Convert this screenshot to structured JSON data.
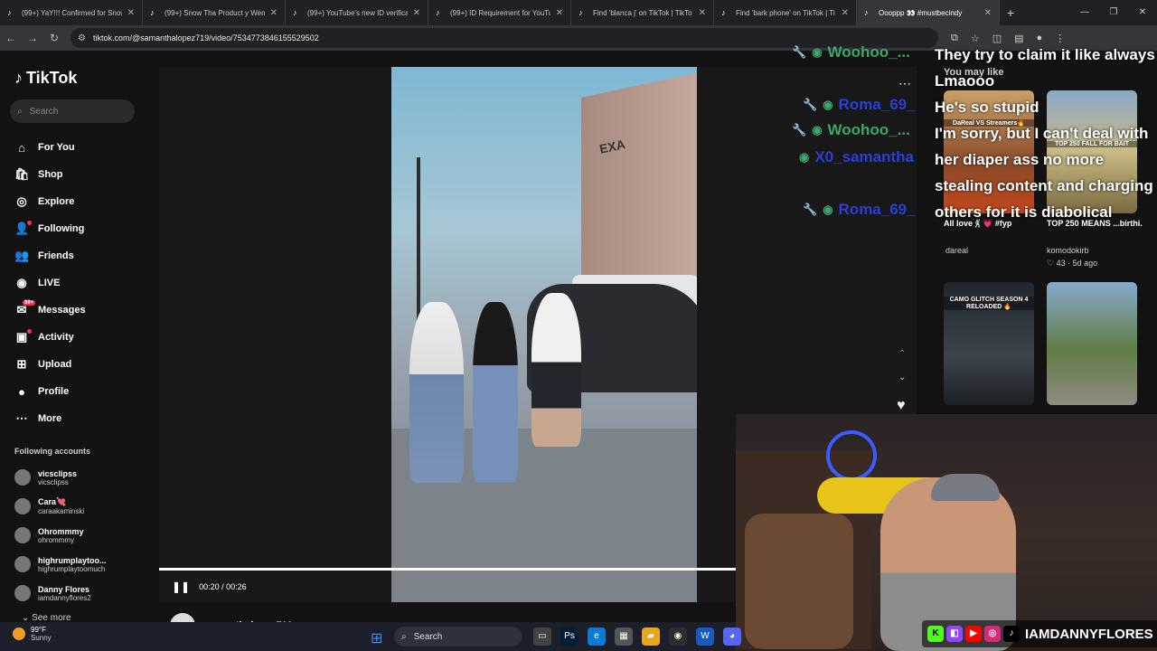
{
  "browser": {
    "tabs": [
      {
        "title": "(99+) YaY!!! Confirmed for Snow",
        "active": false
      },
      {
        "title": "(99+) Snow Tha Product y Wen",
        "active": false
      },
      {
        "title": "(99+) YouTube's new ID verificat",
        "active": false
      },
      {
        "title": "(99+) ID Requirement for YouTu",
        "active": false
      },
      {
        "title": "Find 'blanca j' on TikTok | TikTo",
        "active": false
      },
      {
        "title": "Find 'bark phone' on TikTok | Ti",
        "active": false
      },
      {
        "title": "Oooppp 👀 #mustbecindy",
        "active": true
      }
    ],
    "url": "tiktok.com/@samanthalopez719/video/7534773846155529502"
  },
  "sidebar": {
    "logo_text": "TikTok",
    "search_placeholder": "Search",
    "nav": [
      {
        "label": "For You",
        "icon": "home-icon"
      },
      {
        "label": "Shop",
        "icon": "shop-icon"
      },
      {
        "label": "Explore",
        "icon": "compass-icon"
      },
      {
        "label": "Following",
        "icon": "following-icon"
      },
      {
        "label": "Friends",
        "icon": "friends-icon"
      },
      {
        "label": "LIVE",
        "icon": "live-icon"
      },
      {
        "label": "Messages",
        "icon": "messages-icon",
        "badge": "99+"
      },
      {
        "label": "Activity",
        "icon": "activity-icon"
      },
      {
        "label": "Upload",
        "icon": "upload-icon"
      },
      {
        "label": "Profile",
        "icon": "profile-icon"
      },
      {
        "label": "More",
        "icon": "more-icon"
      }
    ],
    "following_title": "Following accounts",
    "following": [
      {
        "name": "vicsclipss",
        "user": "vicsclipss"
      },
      {
        "name": "Cara💘",
        "user": "caraakaminski"
      },
      {
        "name": "Ohrommmy",
        "user": "ohrommmy"
      },
      {
        "name": "highrumplaytoo...",
        "user": "highrumplaytoomuch"
      },
      {
        "name": "Danny Flores",
        "user": "iamdannyflores2"
      }
    ],
    "see_more": "See more"
  },
  "video": {
    "time": "00:20 / 00:26",
    "progress": 0.77,
    "author": "samanthalopez719",
    "store_sign": "EXA"
  },
  "chat": {
    "names": [
      {
        "text": "Woohoo_...",
        "color": "#3aa86a"
      },
      {
        "text": "Roma_69_",
        "color": "#2a3fd8"
      },
      {
        "text": "Woohoo_...",
        "color": "#3aa86a"
      },
      {
        "text": "X0_samantha",
        "color": "#2a3fd8"
      },
      {
        "text": "Roma_69_",
        "color": "#2a3fd8"
      }
    ],
    "lines": [
      "They try to claim it like always",
      "Lmaooo",
      "He's so stupid",
      "I'm sorry, but I can't deal with her diaper ass no more",
      "stealing content and charging others for it is diabolical"
    ]
  },
  "recommendations": {
    "title": "You may like",
    "items": [
      {
        "label": "DaReal VS Streamers🔥",
        "caption": "All love🕺💗 #fyp",
        "meta_user": "dareal",
        "meta_count": ""
      },
      {
        "label": "TOP 250 FALL FOR BAIT",
        "caption": "TOP 250 MEANS ...birthi...",
        "meta_user": "komodokirb",
        "meta_count": "♡ 43 · 5d ago"
      },
      {
        "label": "CAMO GLITCH SEASON 4 RELOADED 🔥",
        "caption": "",
        "meta_user": "",
        "meta_count": ""
      },
      {
        "label": "",
        "caption": "",
        "meta_user": "",
        "meta_count": ""
      }
    ]
  },
  "stream_overlay": {
    "handle": "IAMDANNYFLORES"
  },
  "taskbar": {
    "temp": "99°F",
    "weather": "Sunny",
    "search": "Search"
  }
}
